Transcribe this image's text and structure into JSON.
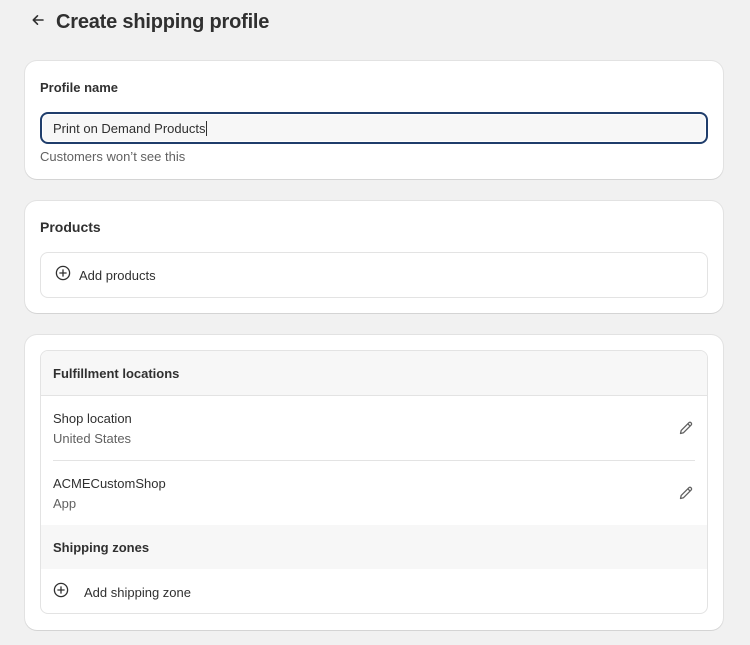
{
  "header": {
    "title": "Create shipping profile",
    "back_icon": "arrow-left-icon"
  },
  "profile": {
    "label": "Profile name",
    "input_value": "Print on Demand Products",
    "help_text": "Customers won’t see this"
  },
  "products": {
    "title": "Products",
    "add_label": "Add products"
  },
  "fulfillment": {
    "title": "Fulfillment locations",
    "locations": [
      {
        "name": "Shop location",
        "sub": "United States"
      },
      {
        "name": "ACMECustomShop",
        "sub": "App"
      }
    ]
  },
  "zones": {
    "title": "Shipping zones",
    "add_label": "Add shipping zone"
  },
  "colors": {
    "focus_border": "#1f3d6b",
    "page_bg": "#f1f1f1",
    "card_bg": "#ffffff"
  }
}
